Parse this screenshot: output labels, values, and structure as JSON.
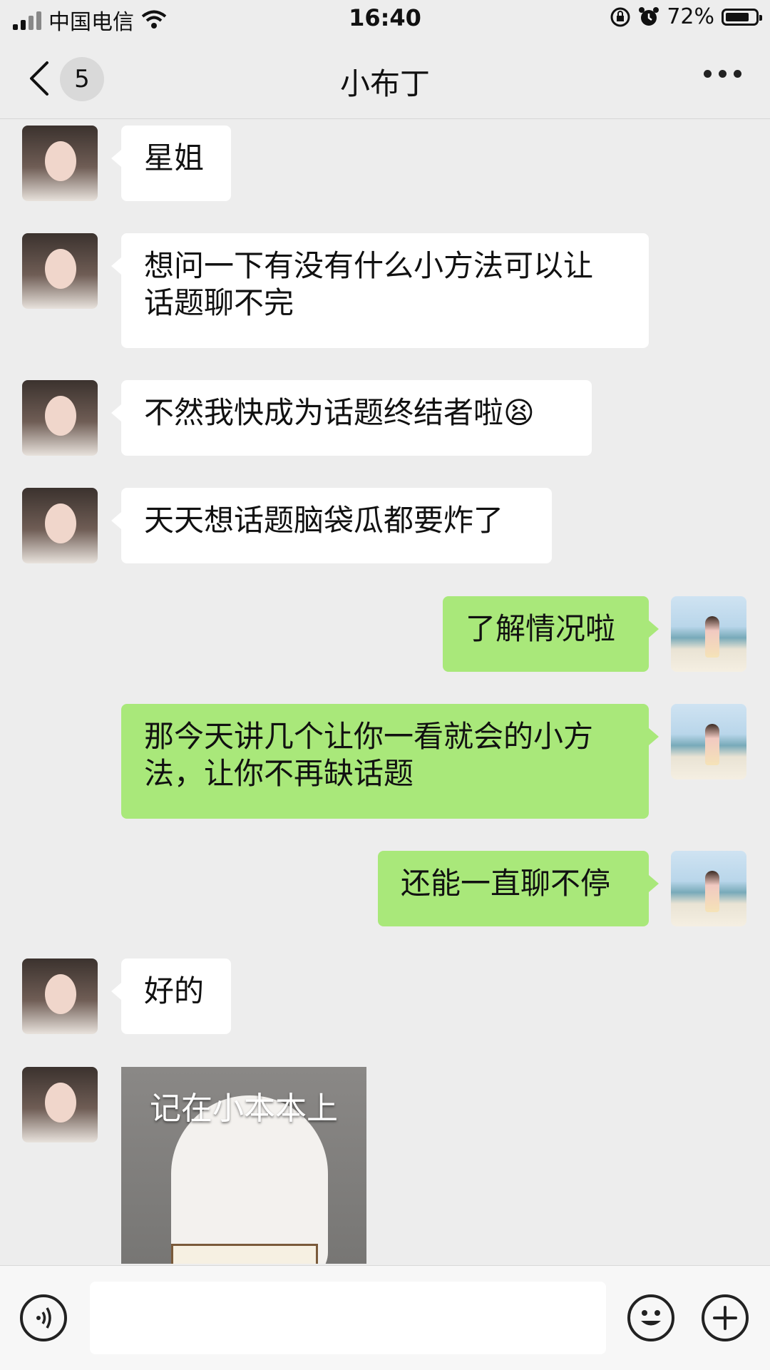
{
  "status_bar": {
    "carrier": "中国电信",
    "time": "16:40",
    "battery_percent": "72%"
  },
  "header": {
    "back_count": "5",
    "title": "小布丁"
  },
  "messages": [
    {
      "from": "contact",
      "text": "星姐"
    },
    {
      "from": "contact",
      "text": "想问一下有没有什么小方法可以让\n话题聊不完"
    },
    {
      "from": "contact",
      "text": "不然我快成为话题终结者啦😫"
    },
    {
      "from": "contact",
      "text": "天天想话题脑袋瓜都要炸了"
    },
    {
      "from": "me",
      "text": "了解情况啦"
    },
    {
      "from": "me",
      "text": "那今天讲几个让你一看就会的小方\n法，让你不再缺话题"
    },
    {
      "from": "me",
      "text": "还能一直聊不停"
    },
    {
      "from": "contact",
      "text": "好的"
    }
  ],
  "sticker": {
    "caption": "记在小本本上"
  },
  "input": {
    "placeholder": ""
  }
}
